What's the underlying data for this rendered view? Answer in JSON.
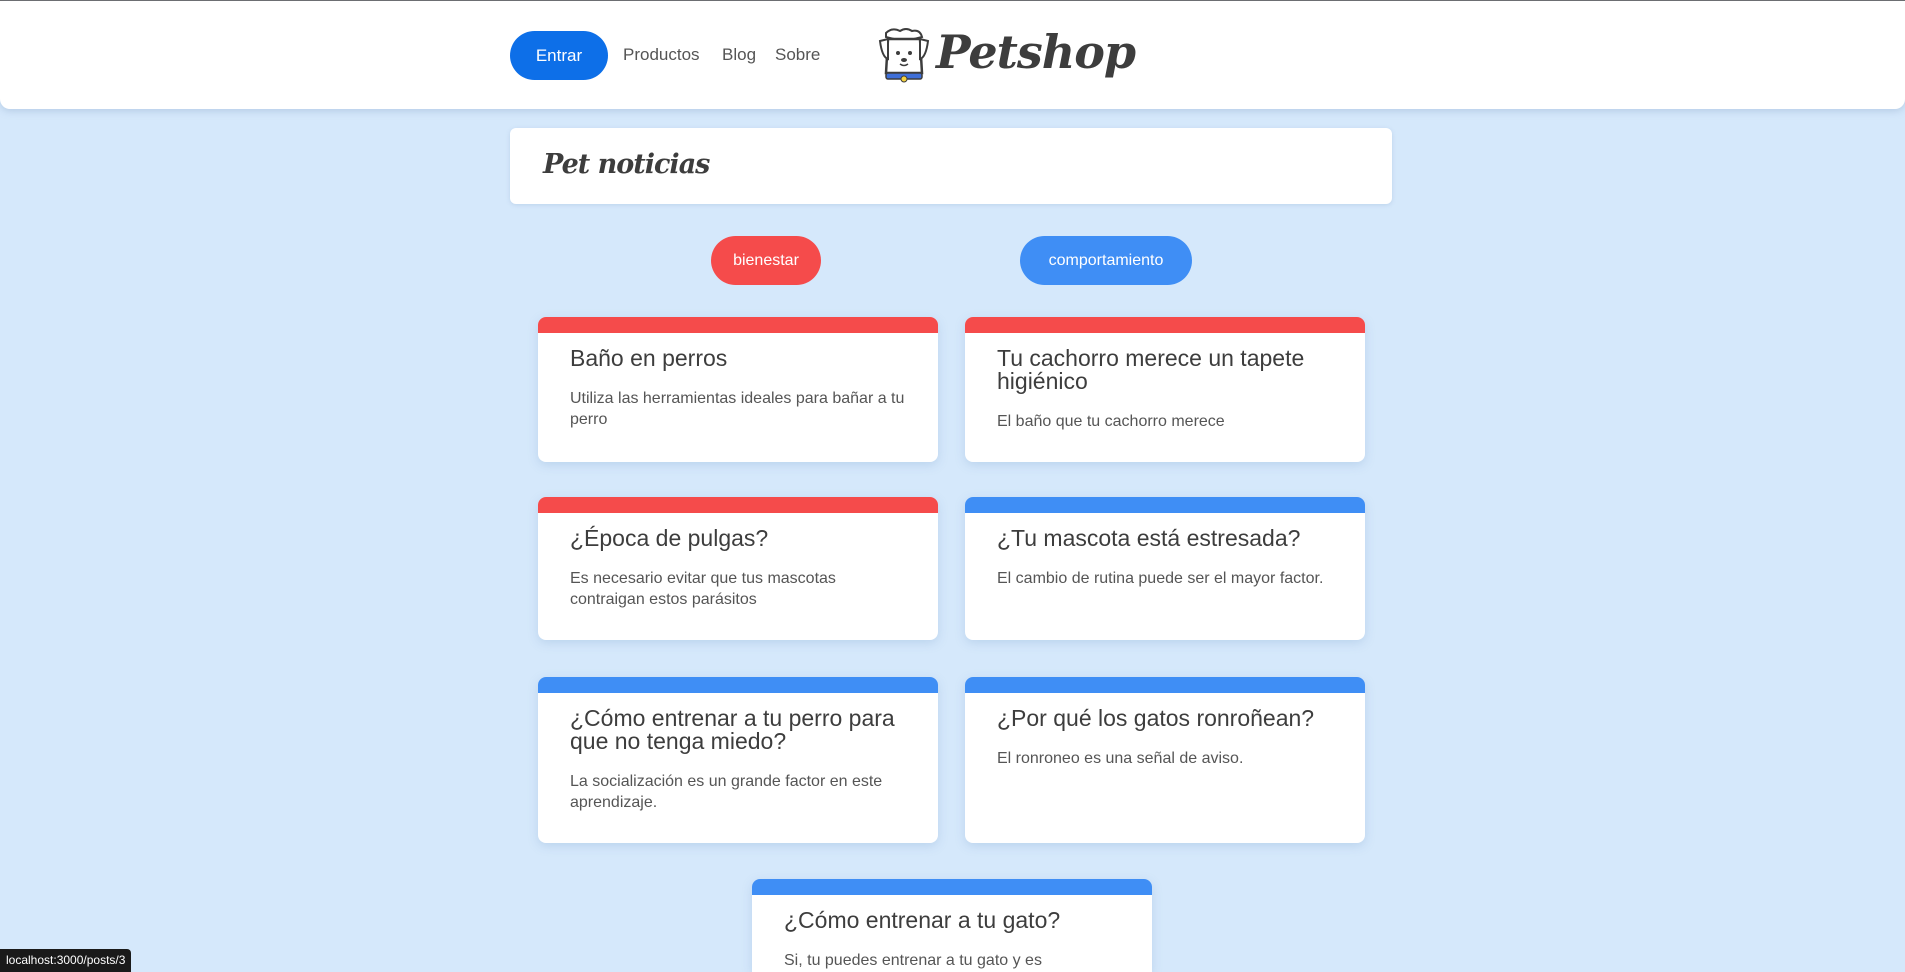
{
  "header": {
    "enter_label": "Entrar",
    "nav": [
      "Productos",
      "Blog",
      "Sobre"
    ],
    "logo_text": "Petshop"
  },
  "main": {
    "title": "Pet noticias",
    "filters": [
      "bienestar",
      "comportamiento"
    ],
    "posts": [
      {
        "title": "Baño en perros",
        "description": "Utiliza las herramientas ideales para bañar a tu perro",
        "category": "bienestar"
      },
      {
        "title": "Tu cachorro merece un tapete higiénico",
        "description": "El baño que tu cachorro merece",
        "category": "bienestar"
      },
      {
        "title": "¿Época de pulgas?",
        "description": "Es necesario evitar que tus mascotas contraigan estos parásitos",
        "category": "bienestar"
      },
      {
        "title": "¿Tu mascota está estresada?",
        "description": "El cambio de rutina puede ser el mayor factor.",
        "category": "comportamiento"
      },
      {
        "title": "¿Cómo entrenar a tu perro para que no tenga miedo?",
        "description": "La socialización es un grande factor en este aprendizaje.",
        "category": "comportamiento"
      },
      {
        "title": "¿Por qué los gatos ronroñean?",
        "description": "El ronroneo es una señal de aviso.",
        "category": "comportamiento"
      },
      {
        "title": "¿Cómo entrenar a tu gato?",
        "description": "Si, tu puedes entrenar a tu gato y es",
        "category": "comportamiento"
      }
    ]
  },
  "status_bar": {
    "url": "localhost:3000/posts/3"
  },
  "colors": {
    "bienestar": "#f54b4b",
    "comportamiento": "#3f8ef5",
    "primary": "#0d6fe8",
    "background": "#d5e8fb"
  }
}
